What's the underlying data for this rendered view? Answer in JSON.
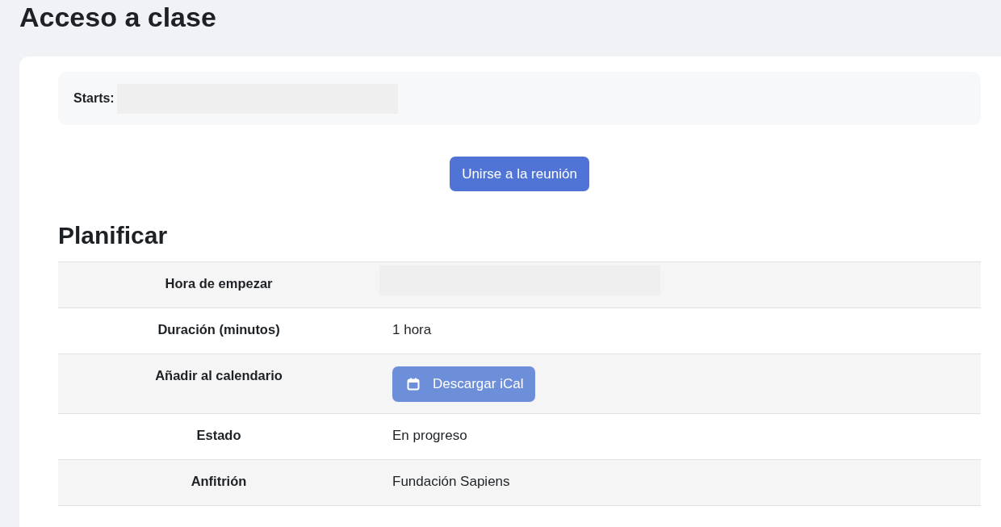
{
  "page_title": "Acceso a clase",
  "starts": {
    "label": "Starts:"
  },
  "join_button": "Unirse a la reunión",
  "schedule": {
    "heading": "Planificar",
    "rows": [
      {
        "label": "Hora de empezar",
        "kind": "redacted"
      },
      {
        "label": "Duración (minutos)",
        "kind": "text",
        "value": "1 hora"
      },
      {
        "label": "Añadir al calendario",
        "kind": "button",
        "value": "Descargar iCal"
      },
      {
        "label": "Estado",
        "kind": "text",
        "value": "En progreso"
      },
      {
        "label": "Anfitrión",
        "kind": "text",
        "value": "Fundación Sapiens"
      }
    ]
  }
}
